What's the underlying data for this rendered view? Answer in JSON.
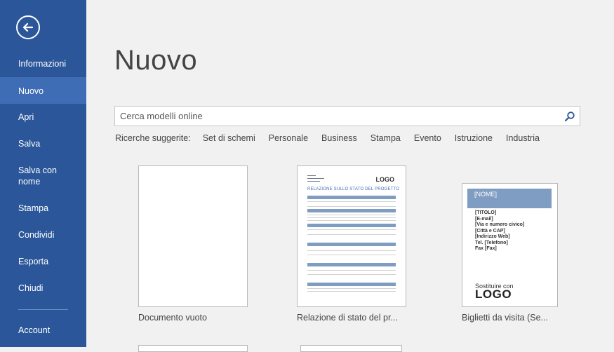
{
  "sidebar": {
    "items": [
      {
        "label": "Informazioni",
        "active": false
      },
      {
        "label": "Nuovo",
        "active": true
      },
      {
        "label": "Apri",
        "active": false
      },
      {
        "label": "Salva",
        "active": false
      },
      {
        "label": "Salva con nome",
        "active": false
      },
      {
        "label": "Stampa",
        "active": false
      },
      {
        "label": "Condividi",
        "active": false
      },
      {
        "label": "Esporta",
        "active": false
      },
      {
        "label": "Chiudi",
        "active": false
      }
    ],
    "account": "Account",
    "back_icon": "back-arrow-icon"
  },
  "main": {
    "title": "Nuovo",
    "search": {
      "placeholder": "Cerca modelli online",
      "value": "",
      "icon": "search-icon"
    },
    "suggested_label": "Ricerche suggerite:",
    "suggested": [
      "Set di schemi",
      "Personale",
      "Business",
      "Stampa",
      "Evento",
      "Istruzione",
      "Industria"
    ],
    "templates": [
      {
        "label": "Documento vuoto"
      },
      {
        "label": "Relazione di stato del pr..."
      },
      {
        "label": "Biglietti da visita (Se..."
      }
    ],
    "report_thumb": {
      "logo": "LOGO",
      "heading": "RELAZIONE SULLO STATO DEL PROGETTO"
    },
    "card_thumb": {
      "name": "[NOME]",
      "lines": [
        "[TITOLO]",
        "[E-mail]",
        "[Via e numero civico]",
        "[Città e CAP]",
        "[Indirizzo Web]",
        "Tel. [Telefono]",
        "Fax [Fax]"
      ],
      "replace": "Sostituire con",
      "logo": "LOGO"
    }
  },
  "colors": {
    "accent": "#2b579a",
    "active": "#3e6db5",
    "background": "#f1f1f1"
  }
}
